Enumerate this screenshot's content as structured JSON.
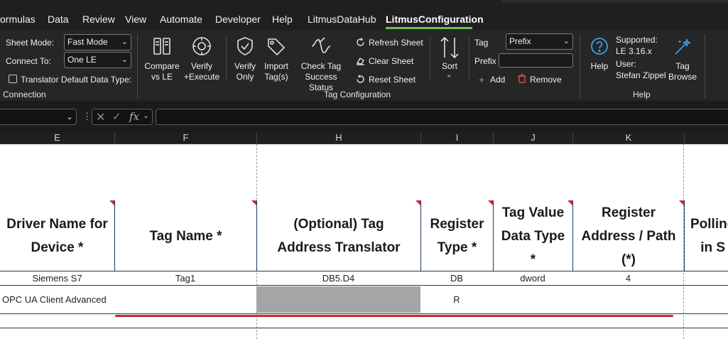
{
  "menu": {
    "items": [
      {
        "label": "ormulas"
      },
      {
        "label": "Data"
      },
      {
        "label": "Review"
      },
      {
        "label": "View"
      },
      {
        "label": "Automate"
      },
      {
        "label": "Developer"
      },
      {
        "label": "Help"
      },
      {
        "label": "LitmusDataHub"
      },
      {
        "label": "LitmusConfiguration",
        "active": true
      }
    ]
  },
  "ribbon": {
    "connection": {
      "sheet_mode_label": "Sheet Mode:",
      "sheet_mode_value": "Fast Mode",
      "connect_to_label": "Connect To:",
      "connect_to_value": "One LE",
      "translator_label": "Translator Default Data Type:",
      "group_label": "Connection"
    },
    "tag_configuration": {
      "compare_label": "Compare\nvs LE",
      "verify_execute_label": "Verify\n+Execute",
      "verify_only_label": "Verify\nOnly",
      "import_label": "Import\nTag(s)",
      "check_tag_label": "Check Tag\nSuccess Status",
      "refresh_label": "Refresh Sheet",
      "clear_label": "Clear Sheet",
      "reset_label": "Reset Sheet",
      "sort_label": "Sort",
      "tag_label": "Tag",
      "tag_value": "Prefix",
      "prefix_label": "Prefix",
      "add_label": "Add",
      "remove_label": "Remove",
      "group_label": "Tag Configuration"
    },
    "help": {
      "help_label": "Help",
      "supported_label": "Supported:",
      "supported_version": "LE 3.16.x",
      "user_label": "User:",
      "user_name": "Stefan Zippel",
      "tag_browse_label": "Tag\nBrowse",
      "group_label": "Help"
    }
  },
  "formula_bar": {
    "fx_label": "fx"
  },
  "sheet": {
    "columns": [
      {
        "letter": "E"
      },
      {
        "letter": "F"
      },
      {
        "letter": "H"
      },
      {
        "letter": "I"
      },
      {
        "letter": "J"
      },
      {
        "letter": "K"
      }
    ],
    "headers": [
      "Driver Name for\nDevice *",
      "Tag Name *",
      "(Optional) Tag\nAddress Translator",
      "Register\nType *",
      "Tag Value\nData Type\n*",
      "Register\nAddress / Path\n(*)",
      "Polling\nin S"
    ],
    "rows": [
      [
        "Siemens S7",
        "Tag1",
        "DB5.D4",
        "DB",
        "dword",
        "4"
      ],
      [
        "OPC UA Client Advanced",
        "",
        "",
        "R",
        "",
        ""
      ]
    ]
  },
  "colors": {
    "ribbon_bg": "#262626",
    "accent_green": "#6cc24a",
    "required_marker": "#d6202a",
    "highlight_red": "#cc2a2a",
    "remove_red": "#d9534f",
    "help_blue": "#3aa0e8"
  },
  "icons": [
    "compare-icon",
    "verify-execute-icon",
    "verify-only-icon",
    "import-tag-icon",
    "check-tag-icon",
    "refresh-icon",
    "clear-icon",
    "reset-icon",
    "sort-icon",
    "plus-icon",
    "trash-icon",
    "help-icon",
    "tag-browse-icon"
  ]
}
